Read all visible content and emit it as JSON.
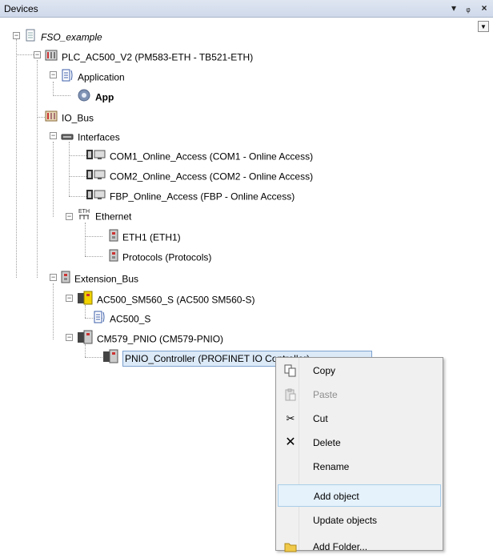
{
  "panel": {
    "title": "Devices",
    "dropdown_icon": "dropdown-arrow-icon",
    "pin_icon": "pin-icon",
    "close_icon": "close-icon"
  },
  "tree": {
    "root": "FSO_example",
    "plc": "PLC_AC500_V2 (PM583-ETH - TB521-ETH)",
    "application": "Application",
    "app": "App",
    "io_bus": "IO_Bus",
    "interfaces": "Interfaces",
    "com1": "COM1_Online_Access (COM1 - Online Access)",
    "com2": "COM2_Online_Access (COM2 - Online Access)",
    "fbp": "FBP_Online_Access (FBP - Online Access)",
    "ethernet": "Ethernet",
    "eth1": "ETH1 (ETH1)",
    "protocols": "Protocols (Protocols)",
    "extension_bus": "Extension_Bus",
    "sm560": "AC500_SM560_S (AC500 SM560-S)",
    "ac500_s": "AC500_S",
    "cm579": "CM579_PNIO (CM579-PNIO)",
    "pnio_controller": "PNIO_Controller (PROFINET IO Controller)"
  },
  "context_menu": {
    "items": [
      {
        "label": "Copy",
        "icon": "copy-icon",
        "enabled": true
      },
      {
        "label": "Paste",
        "icon": "paste-icon",
        "enabled": false
      },
      {
        "label": "Cut",
        "icon": "scissors-icon",
        "enabled": true
      },
      {
        "label": "Delete",
        "icon": "delete-x-icon",
        "enabled": true
      },
      {
        "label": "Rename",
        "icon": "",
        "enabled": true
      },
      {
        "label": "Add object",
        "icon": "",
        "enabled": true,
        "highlighted": true
      },
      {
        "label": "Update objects",
        "icon": "",
        "enabled": true
      },
      {
        "label": "Add Folder...",
        "icon": "folder-icon",
        "enabled": true
      }
    ]
  }
}
